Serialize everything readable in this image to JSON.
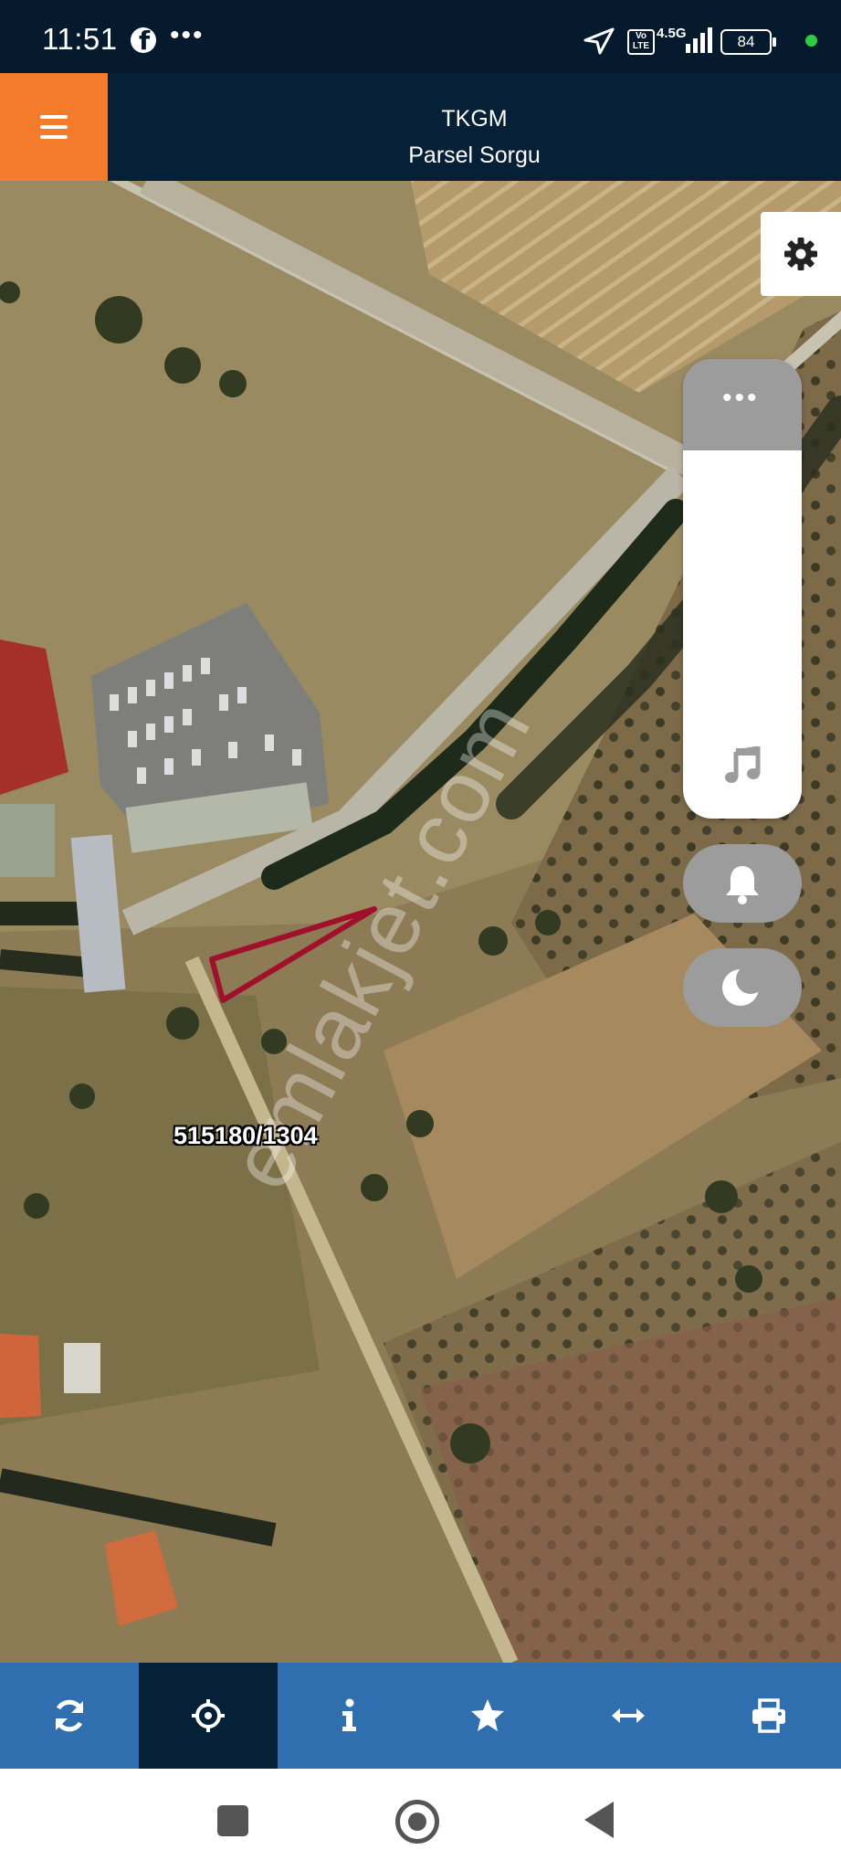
{
  "status_bar": {
    "time": "11:51",
    "overflow": "•••",
    "network": "4.5G",
    "volte": "Vo LTE",
    "battery": "84",
    "icons": [
      "facebook-icon",
      "location-arrow-icon",
      "signal-icon",
      "battery-icon"
    ]
  },
  "header": {
    "title_line1": "TKGM",
    "title_line2": "Parsel Sorgu",
    "menu_icon": "hamburger-menu-icon",
    "menu_color": "#f47a2c",
    "background": "#062038"
  },
  "map": {
    "parcel_label": "515180/1304",
    "watermark": "emlakjet.com",
    "parcel_outline_color": "#a0102a"
  },
  "side_controls": {
    "settings_icon": "gear-icon",
    "panel_top_icon": "more-icon",
    "panel_top_text": "•••",
    "music_icon": "music-note-icon",
    "bell_icon": "bell-icon",
    "moon_icon": "moon-icon"
  },
  "toolbar": {
    "background": "#2f6faf",
    "active_background": "#062038",
    "items": [
      {
        "icon": "refresh-icon",
        "active": false
      },
      {
        "icon": "crosshair-icon",
        "active": true
      },
      {
        "icon": "info-icon",
        "active": false
      },
      {
        "icon": "star-icon",
        "active": false
      },
      {
        "icon": "arrows-horizontal-icon",
        "active": false
      },
      {
        "icon": "print-icon",
        "active": false
      }
    ]
  },
  "nav_bar": {
    "icons": [
      "recents-square-icon",
      "home-circle-icon",
      "back-triangle-icon"
    ]
  }
}
